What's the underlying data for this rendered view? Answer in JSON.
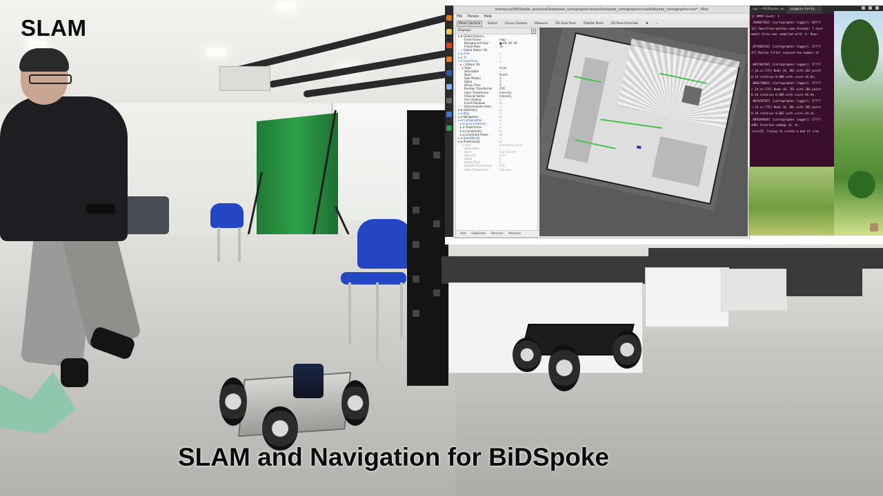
{
  "video": {
    "corner_label": "SLAM",
    "caption": "SLAM and Navigation for BiDSpoke"
  },
  "rviz": {
    "window_title": "/home/yzy/BiDSpoke_ws/install/bidspoke_cartographer/share/bidspoke_cartographer/rviz/bidspoke_cartographer.rviz* - RViz",
    "menu": [
      "File",
      "Panels",
      "Help"
    ],
    "toolbar": [
      "Move Camera",
      "Select",
      "Focus Camera",
      "Measure",
      "2D Goal Pose",
      "Publish Point",
      "2D Pose Estimate"
    ],
    "toolbar_active": "Move Camera",
    "displays_panel": {
      "title": "Displays",
      "close_label": "×",
      "rows": [
        {
          "k": "▾ ⚙ Global Options",
          "v": "",
          "indent": 0
        },
        {
          "k": "Fixed Frame",
          "v": "map",
          "indent": 3
        },
        {
          "k": "Background Color",
          "v": "■ 48; 48; 48",
          "indent": 3
        },
        {
          "k": "Frame Rate",
          "v": "30",
          "indent": 3
        },
        {
          "k": "✓ Global Status: Ok",
          "v": "",
          "indent": 1
        },
        {
          "k": "▸ ⊞ Grid",
          "v": "✓",
          "indent": 0,
          "hl": true
        },
        {
          "k": "▸ ⊞ TF",
          "v": "✓",
          "indent": 0,
          "hl": true
        },
        {
          "k": "▾ ⊞ LaserScan",
          "v": "✓",
          "indent": 0,
          "hl": true
        },
        {
          "k": "▸ ✓ Status: Ok",
          "v": "",
          "indent": 1
        },
        {
          "k": "▸ Topic",
          "v": "/scan",
          "indent": 2
        },
        {
          "k": "Selectable",
          "v": "✓",
          "indent": 3
        },
        {
          "k": "Style",
          "v": "Points",
          "indent": 3
        },
        {
          "k": "Size (Pixels)",
          "v": "3",
          "indent": 3
        },
        {
          "k": "Alpha",
          "v": "1",
          "indent": 3
        },
        {
          "k": "Decay Time",
          "v": "0",
          "indent": 3
        },
        {
          "k": "Position Transformer",
          "v": "XYZ",
          "indent": 3
        },
        {
          "k": "Color Transformer",
          "v": "Intensity",
          "indent": 3
        },
        {
          "k": "Channel Name",
          "v": "intensity",
          "indent": 3
        },
        {
          "k": "Use rainbow",
          "v": "✓",
          "indent": 3
        },
        {
          "k": "Invert Rainbow",
          "v": "☐",
          "indent": 3
        },
        {
          "k": "Autocompute Inten...",
          "v": "✓",
          "indent": 3
        },
        {
          "k": "▸ ⊞ Odometry",
          "v": "☐",
          "indent": 0
        },
        {
          "k": "▸ ⊞ Map",
          "v": "✓",
          "indent": 0,
          "hl": true
        },
        {
          "k": "▸ ⊞ Navigation",
          "v": "☐",
          "indent": 0
        },
        {
          "k": "▾ ⊞ Cartographer",
          "v": "✓",
          "indent": 0,
          "hl": true
        },
        {
          "k": "▸ ⊞ scan_matched_...",
          "v": "✓",
          "indent": 1,
          "hl": true
        },
        {
          "k": "▸ ⊞ Trajectories",
          "v": "✓",
          "indent": 1
        },
        {
          "k": "▸ ⊞ Constraints",
          "v": "☐",
          "indent": 1
        },
        {
          "k": "▸ ⊞ Landmark Poses",
          "v": "☐",
          "indent": 1
        },
        {
          "k": "▸ ⊞ RobotModel",
          "v": "✓",
          "indent": 0,
          "hl": true
        },
        {
          "k": "▾ ⊞ PointCloud2",
          "v": "☐",
          "indent": 0
        },
        {
          "k": "▸ Topic",
          "v": "/landmark_poses",
          "indent": 2,
          "dim": true
        },
        {
          "k": "Selectable",
          "v": "✓",
          "indent": 3,
          "dim": true
        },
        {
          "k": "Style",
          "v": "Flat Squares",
          "indent": 3,
          "dim": true
        },
        {
          "k": "Size (m)",
          "v": "0.01",
          "indent": 3,
          "dim": true
        },
        {
          "k": "Alpha",
          "v": "1",
          "indent": 3,
          "dim": true
        },
        {
          "k": "Decay Time",
          "v": "0",
          "indent": 3,
          "dim": true
        },
        {
          "k": "Position Transformer",
          "v": "XYZ",
          "indent": 3,
          "dim": true
        },
        {
          "k": "Color Transformer",
          "v": "Intensity",
          "indent": 3,
          "dim": true
        }
      ],
      "footer": [
        "Add",
        "Duplicate",
        "Remove",
        "Rename"
      ]
    }
  },
  "terminal": {
    "tabs": [
      "ngc:~/BiDSpoke_ws",
      "yzy@yzy-Certa..."
    ],
    "header_right": "Count: 1",
    "header_marker": "####",
    "lines": [
      "j]                    ####    Count: 1",
      ".784667583] [cartographer logger]: W1???",
      "12] Specified options.num_threads: 7 exce",
      "  model Ceres was compiled with: 4.  Roun",
      "",
      ".077866742] [cartographer logger]: I????",
      "47] Motion filter reduced the number of",
      "",
      ".045704784] [cartographer logger]: I????",
      "r_2d.cc:775] Node (0, 80) with 282 point",
      " 0.14 rotation 0.006 with score 46.6%.",
      ".060270681] [cartographer logger]: I????",
      "r_2d.cc:775] Node (0, 76) with 286 point",
      " 0.18 rotation 0.005 with score 45.6%.",
      ".065450787] [cartographer logger]: I????",
      "r_2d.cc:775] Node (0, 80) with 285 point",
      " 0.19 rotation 0.007 with score 44.1%.",
      ".009194668] [cartographer logger]: I????",
      "448] Inserted submap (0, 4).",
      "(rviz2]: Trying to create a map of size"
    ]
  },
  "colors": {
    "terminal_bg": "#3b0f2c",
    "rviz_bg": "#ececec",
    "map_free": "#dedede",
    "scan_points": "#46c24a"
  }
}
